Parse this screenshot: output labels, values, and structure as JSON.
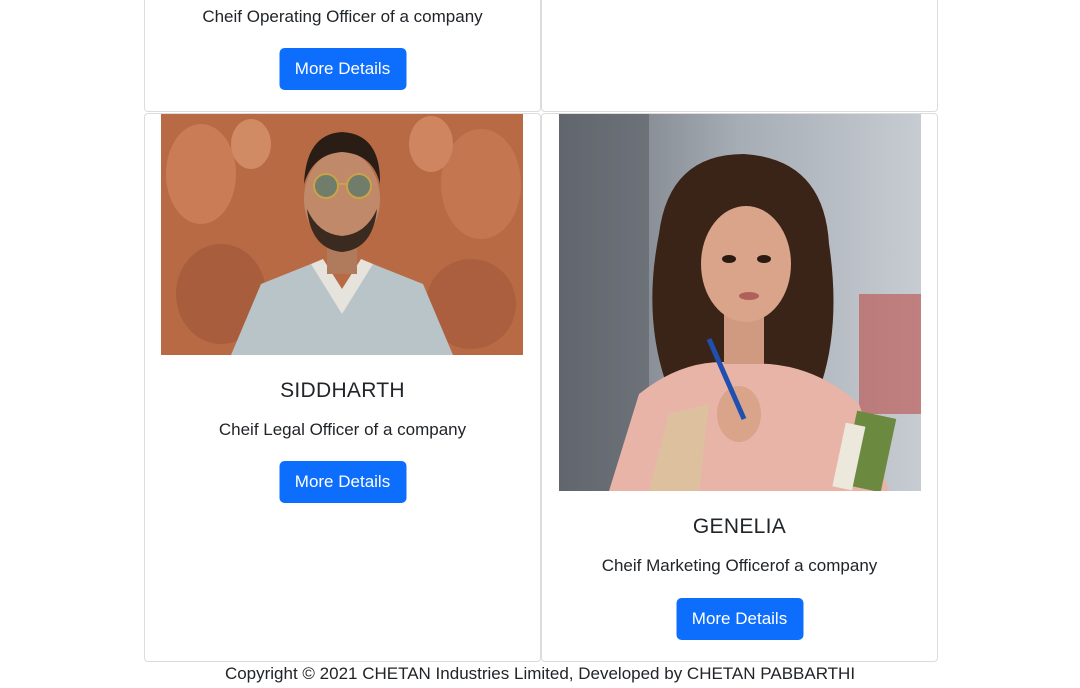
{
  "cards": [
    {
      "role": "Cheif Operating Officer of a company",
      "button": "More Details"
    },
    {
      "name": "SIDDHARTH",
      "role": "Cheif Legal Officer of a company",
      "button": "More Details",
      "photo_colors": {
        "background": "#b86a45",
        "jacket": "#b9c4c9",
        "skin": "#c08a6a",
        "hair": "#2a1d15"
      }
    },
    {
      "name": "GENELIA",
      "role": "Cheif Marketing Officerof a company",
      "button": "More Details",
      "photo_colors": {
        "background": "#9aa0a8",
        "top": "#e8b4a8",
        "skin": "#d9a48a",
        "hair": "#3a2418"
      }
    }
  ],
  "footer": {
    "text": "Copyright © 2021 CHETAN Industries Limited, Developed by CHETAN PABBARTHI"
  },
  "theme": {
    "button_color": "#0d6efd",
    "border_color": "#dcdcdc"
  }
}
